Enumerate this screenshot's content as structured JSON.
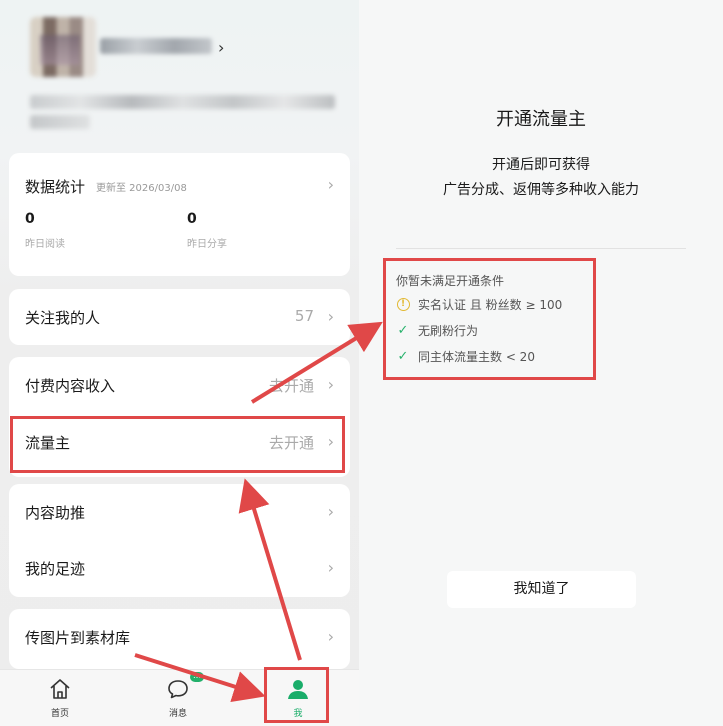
{
  "profile": {
    "name_chevron": "›"
  },
  "stats": {
    "title": "数据统计",
    "updated": "更新至 2026/03/08",
    "items": [
      {
        "value": "0",
        "label": "昨日阅读"
      },
      {
        "value": "0",
        "label": "昨日分享"
      }
    ]
  },
  "menu": {
    "followers": {
      "label": "关注我的人",
      "value": "57"
    },
    "paid": {
      "label": "付费内容收入",
      "value": "去开通"
    },
    "traffic": {
      "label": "流量主",
      "value": "去开通"
    },
    "boost": {
      "label": "内容助推"
    },
    "footprint": {
      "label": "我的足迹"
    },
    "upload": {
      "label": "传图片到素材库"
    },
    "chevron": "›"
  },
  "tabbar": {
    "home": "首页",
    "messages": "消息",
    "me": "我",
    "badge": "…"
  },
  "dialog": {
    "title": "开通流量主",
    "line1": "开通后即可获得",
    "line2": "广告分成、返佣等多种收入能力",
    "conditions_title": "你暂未满足开通条件",
    "conditions": [
      {
        "icon": "warning-icon",
        "text": "实名认证 且 粉丝数 ≥ 100"
      },
      {
        "icon": "check-icon",
        "text": "无刷粉行为"
      },
      {
        "icon": "check-icon",
        "text": "同主体流量主数 < 20"
      }
    ],
    "button": "我知道了"
  },
  "colors": {
    "accent": "#1aad6a",
    "annotation": "#e04848",
    "warning": "#e2b933"
  }
}
